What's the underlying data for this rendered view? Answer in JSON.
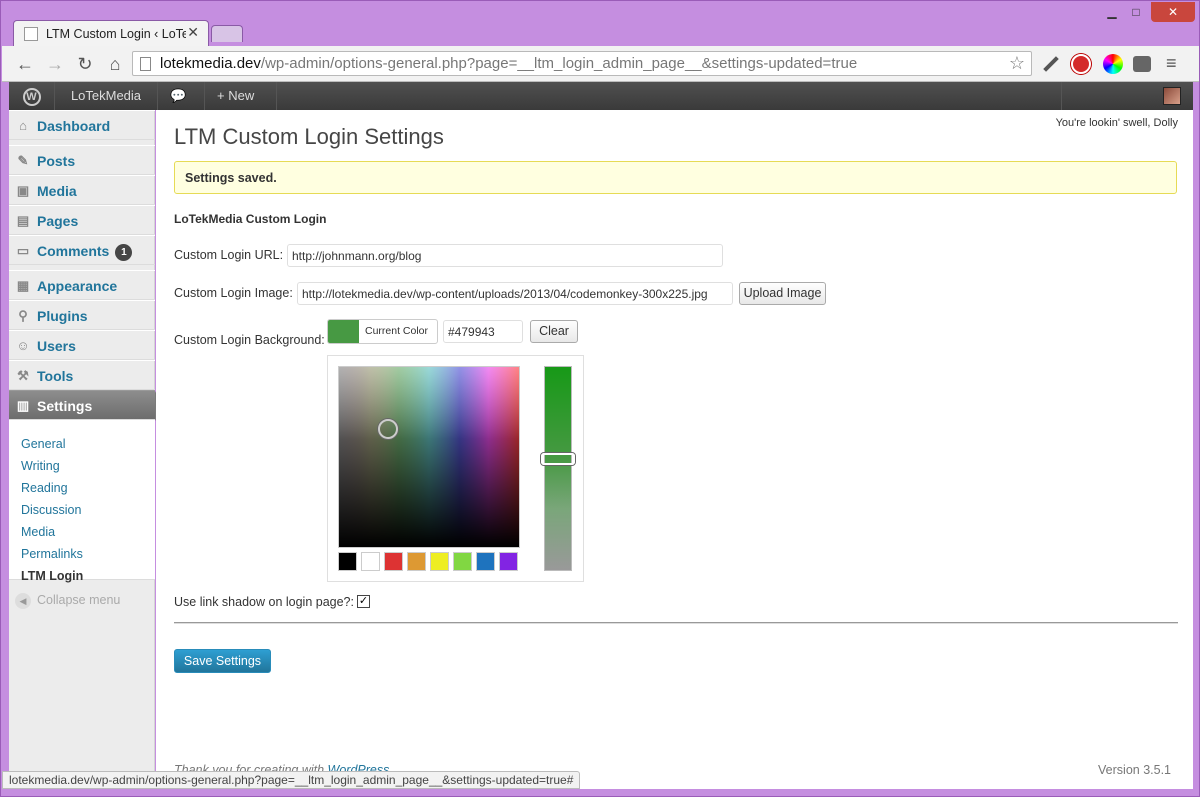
{
  "browser": {
    "tab_title": "LTM Custom Login ‹ LoTe",
    "url_host": "lotekmedia.dev",
    "url_path": "/wp-admin/options-general.php?page=__ltm_login_admin_page__&settings-updated=true",
    "status_url": "lotekmedia.dev/wp-admin/options-general.php?page=__ltm_login_admin_page__&settings-updated=true#"
  },
  "adminbar": {
    "site_name": "LoTekMedia",
    "comments_count": "1",
    "new_label": "New"
  },
  "sidebar": {
    "items": [
      {
        "label": "Dashboard",
        "icon": "dashboard-icon"
      },
      {
        "label": "Posts",
        "icon": "pin-icon"
      },
      {
        "label": "Media",
        "icon": "media-icon"
      },
      {
        "label": "Pages",
        "icon": "pages-icon"
      },
      {
        "label": "Comments",
        "icon": "comments-icon",
        "badge": "1"
      },
      {
        "label": "Appearance",
        "icon": "appearance-icon"
      },
      {
        "label": "Plugins",
        "icon": "plugins-icon"
      },
      {
        "label": "Users",
        "icon": "users-icon"
      },
      {
        "label": "Tools",
        "icon": "tools-icon"
      },
      {
        "label": "Settings",
        "icon": "settings-icon"
      }
    ],
    "submenu": [
      "General",
      "Writing",
      "Reading",
      "Discussion",
      "Media",
      "Permalinks",
      "LTM Login"
    ],
    "collapse_label": "Collapse menu"
  },
  "main": {
    "dolly_text": "You're lookin' swell, Dolly",
    "title": "LTM Custom Login Settings",
    "notice": "Settings saved.",
    "section_title": "LoTekMedia Custom Login",
    "url_label": "Custom Login URL:",
    "url_value": "http://johnmann.org/blog",
    "image_label": "Custom Login Image:",
    "image_value": "http://lotekmedia.dev/wp-content/uploads/2013/04/codemonkey-300x225.jpg",
    "upload_label": "Upload Image",
    "bg_label": "Custom Login Background:",
    "current_color_label": "Current Color",
    "color_value": "#479943",
    "clear_label": "Clear",
    "palette": [
      "#000000",
      "#ffffff",
      "#dd3333",
      "#dd9933",
      "#eeee22",
      "#81d742",
      "#1e73be",
      "#8224e3"
    ],
    "shadow_label": "Use link shadow on login page?:",
    "shadow_checked": true,
    "save_label": "Save Settings"
  },
  "footer": {
    "thanks_prefix": "Thank you for creating with ",
    "thanks_link": "WordPress",
    "version": "Version 3.5.1"
  },
  "colors": {
    "accent": "#21759b",
    "selected_color": "#479943"
  }
}
